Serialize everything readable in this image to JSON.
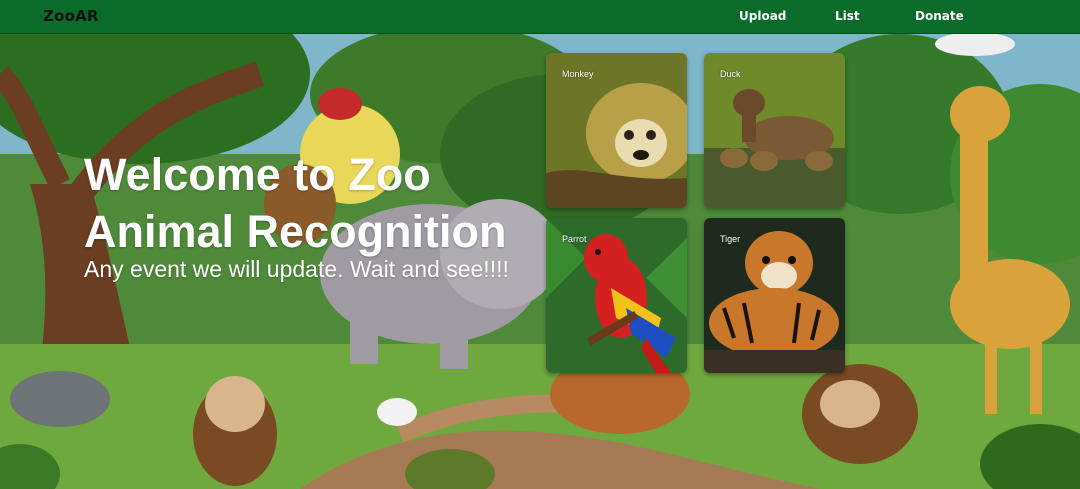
{
  "navbar": {
    "brand": "ZooAR",
    "links": {
      "upload": "Upload",
      "list": "List",
      "donate": "Donate"
    },
    "background_color": "#0a6b2b"
  },
  "hero": {
    "title": "Welcome to Zoo Animal Recognition",
    "subtitle": "Any event we will update. Wait and see!!!!"
  },
  "cards": [
    {
      "label": "Monkey",
      "icon": "monkey-photo"
    },
    {
      "label": "Duck",
      "icon": "duck-photo"
    },
    {
      "label": "Parrot",
      "icon": "parrot-photo"
    },
    {
      "label": "Tiger",
      "icon": "tiger-photo"
    }
  ]
}
